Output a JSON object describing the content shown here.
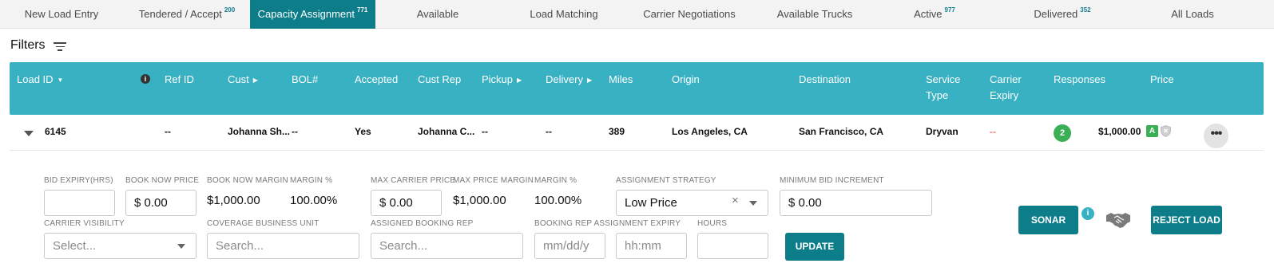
{
  "tabs": [
    {
      "label": "New Load Entry",
      "count": ""
    },
    {
      "label": "Tendered / Accept",
      "count": "200"
    },
    {
      "label": "Capacity Assignment",
      "count": "771"
    },
    {
      "label": "Available",
      "count": ""
    },
    {
      "label": "Load Matching",
      "count": ""
    },
    {
      "label": "Carrier Negotiations",
      "count": ""
    },
    {
      "label": "Available Trucks",
      "count": ""
    },
    {
      "label": "Active",
      "count": "977"
    },
    {
      "label": "Delivered",
      "count": "352"
    },
    {
      "label": "All Loads",
      "count": ""
    }
  ],
  "filters_label": "Filters",
  "columns": {
    "load_id": "Load ID",
    "ref_id": "Ref ID",
    "cust": "Cust",
    "bol": "BOL#",
    "accepted": "Accepted",
    "cust_rep": "Cust Rep",
    "pickup": "Pickup",
    "delivery": "Delivery",
    "miles": "Miles",
    "origin": "Origin",
    "destination": "Destination",
    "service_type_1": "Service",
    "service_type_2": "Type",
    "carrier_expiry_1": "Carrier",
    "carrier_expiry_2": "Expiry",
    "responses": "Responses",
    "price": "Price"
  },
  "row": {
    "load_id": "6145",
    "ref_id": "--",
    "cust": "Johanna Sh...",
    "bol": "--",
    "accepted": "Yes",
    "cust_rep": "Johanna C...",
    "pickup": "--",
    "delivery": "--",
    "miles": "389",
    "origin": "Los Angeles, CA",
    "destination": "San Francisco, CA",
    "service_type": "Dryvan",
    "carrier_expiry": "--",
    "responses": "2",
    "price": "$1,000.00",
    "price_badge": "A",
    "more": "•••"
  },
  "details": {
    "bid_expiry_label": "BID EXPIRY(HRS)",
    "bid_expiry_value": "",
    "book_now_price_label": "BOOK NOW PRICE",
    "book_now_price_value": "$ 0.00",
    "book_now_margin_label": "BOOK NOW MARGIN",
    "book_now_margin_value": "$1,000.00",
    "margin_pct_label": "MARGIN %",
    "margin_pct_value": "100.00%",
    "max_carrier_price_label": "MAX CARRIER PRICE",
    "max_carrier_price_value": "$ 0.00",
    "max_price_margin_label": "MAX PRICE MARGIN",
    "max_price_margin_value": "$1,000.00",
    "margin_pct2_label": "MARGIN %",
    "margin_pct2_value": "100.00%",
    "assignment_strategy_label": "ASSIGNMENT STRATEGY",
    "assignment_strategy_value": "Low Price",
    "clear_symbol": "×",
    "min_bid_increment_label": "MINIMUM BID INCREMENT",
    "min_bid_increment_value": "$ 0.00",
    "carrier_visibility_label": "CARRIER VISIBILITY",
    "carrier_visibility_placeholder": "Select...",
    "coverage_bu_label": "COVERAGE BUSINESS UNIT",
    "coverage_bu_placeholder": "Search...",
    "assigned_booking_rep_label": "ASSIGNED BOOKING REP",
    "assigned_booking_rep_placeholder": "Search...",
    "booking_rep_expiry_label": "BOOKING REP ASSIGNMENT EXPIRY",
    "date_placeholder": "mm/dd/y",
    "time_placeholder": "hh:mm",
    "hours_label": "HOURS",
    "hours_value": "",
    "update_button": "UPDATE",
    "sonar_button": "SONAR",
    "sonar_info": "i",
    "reject_button": "REJECT LOAD"
  },
  "colors": {
    "accent": "#0e7d8a",
    "header": "#38b1c3",
    "green": "#3aaf55",
    "red": "#e0342b"
  }
}
